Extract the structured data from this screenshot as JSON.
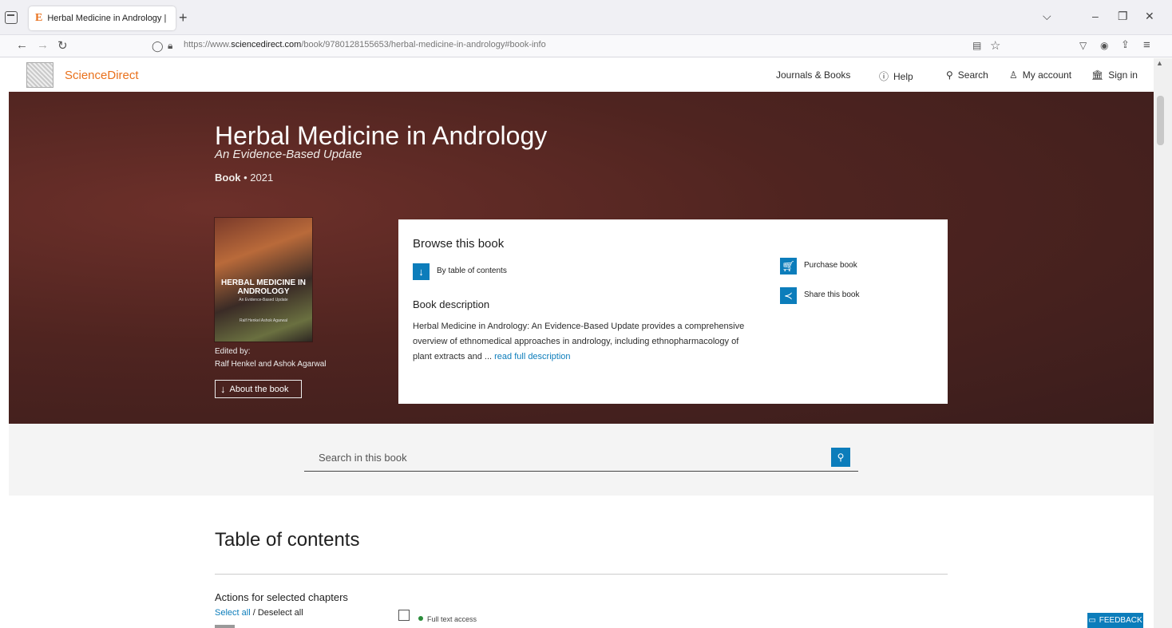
{
  "browser": {
    "tab_title": "Herbal Medicine in Andrology | ×",
    "tab_favicon": "E",
    "url_prefix": "https://www.",
    "url_domain": "sciencedirect.com",
    "url_path": "/book/9780128155653/herbal-medicine-in-andrology#book-info"
  },
  "site": {
    "logo_text": "ScienceDirect",
    "nav": {
      "journals": "Journals & Books",
      "help": "Help",
      "search": "Search",
      "account": "My account",
      "signin": "Sign in"
    }
  },
  "book": {
    "title": "Herbal Medicine in Andrology",
    "subtitle": "An Evidence-Based Update",
    "type": "Book",
    "year": "2021",
    "cover_title": "HERBAL MEDICINE IN ANDROLOGY",
    "cover_subtitle": "An Evidence-Based Update",
    "cover_editors": "Ralf Henkel Ashok Agarwal",
    "edited_by_label": "Edited by:",
    "editors": "Ralf Henkel and Ashok Agarwal",
    "about_label": "About the book"
  },
  "browse": {
    "heading": "Browse this book",
    "toc_link": "By table of contents",
    "desc_heading": "Book description",
    "description": "Herbal Medicine in Andrology: An Evidence-Based Update provides a comprehensive overview of ethnomedical approaches in andrology, including ethnopharmacology of plant extracts and ...",
    "read_more": "read full description",
    "purchase": "Purchase book",
    "share": "Share this book"
  },
  "search_book": {
    "placeholder": "Search in this book"
  },
  "toc": {
    "heading": "Table of contents",
    "actions_heading": "Actions for selected chapters",
    "select_all": "Select all",
    "separator": "/",
    "deselect_all": "Deselect all",
    "full_text": "Full text access"
  },
  "feedback": "FEEDBACK",
  "colors": {
    "brand_orange": "#e9711c",
    "link_blue": "#0c7dbb",
    "hero_bg": "#4f2420"
  }
}
